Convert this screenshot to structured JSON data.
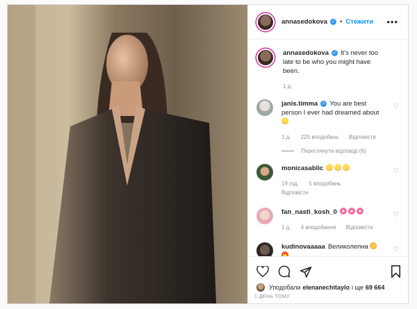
{
  "post": {
    "username": "annasedokova",
    "follow_label": "Стежити",
    "more_label": "•••",
    "separator": "•",
    "caption": {
      "username": "annasedokova",
      "text": "It's never too late to be who you might have been.",
      "time": "1 д."
    },
    "comments": [
      {
        "username": "janis.timma",
        "text": "You are best person I ever had dreamed about",
        "time": "1 д.",
        "likes": "225 вподобань",
        "reply": "Відповісти",
        "view_replies": "Переглянути відповіді (6)"
      },
      {
        "username": "monicasablic",
        "text": "",
        "time": "19 год.",
        "likes": "5 вподобань",
        "reply": "Відповісти"
      },
      {
        "username": "fan_nasti_kosh_0",
        "text": "",
        "time": "1 д.",
        "likes": "4 вподобання",
        "reply": "Відповісти"
      },
      {
        "username": "kudinovaaaaa",
        "text": "Великолепна",
        "time": "",
        "likes": "",
        "reply": ""
      }
    ],
    "liked_by": {
      "prefix": "Уподобали",
      "user": "elenanechitaylo",
      "joiner": "і ще",
      "count": "69 664"
    },
    "posted_ago": "1 день тому"
  },
  "icons": [
    "heart-icon",
    "comment-icon",
    "share-icon",
    "bookmark-icon",
    "verified-icon",
    "more-icon"
  ],
  "colors": {
    "accent": "#0095f6",
    "verified": "#3897f0",
    "meta": "#8e8e8e",
    "border": "#dbdbdb"
  }
}
